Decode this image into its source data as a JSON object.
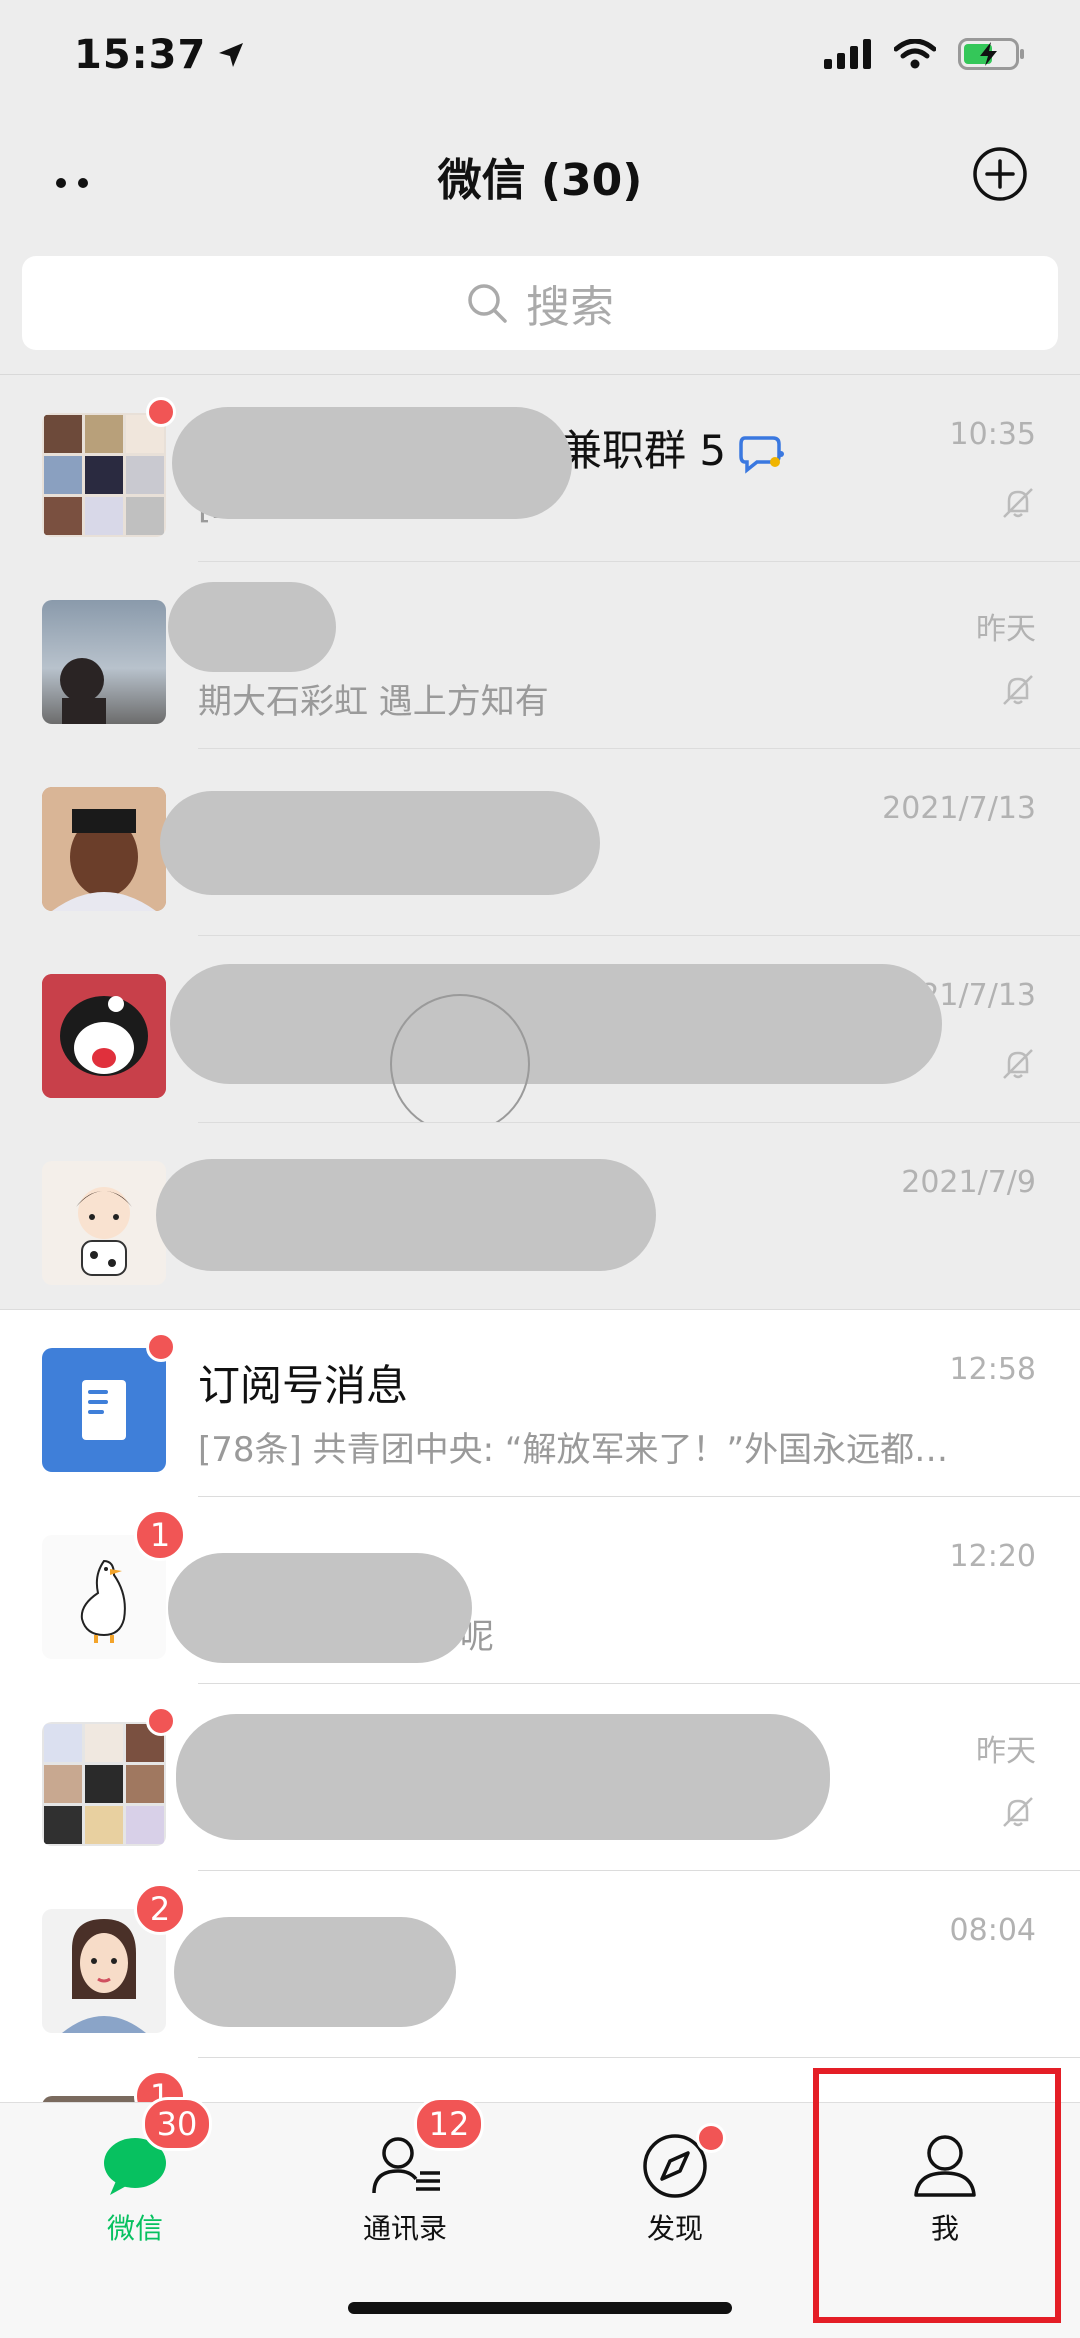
{
  "status_bar": {
    "time": "15:37"
  },
  "header": {
    "title": "微信 (30)"
  },
  "search": {
    "placeholder": "搜索"
  },
  "chats": [
    {
      "name": "兼职群 5",
      "preview": "[23…",
      "time": "10:35",
      "muted": true
    },
    {
      "name": "",
      "preview": "期大石彩虹 遇上方知有",
      "time": "昨天",
      "muted": true
    },
    {
      "name": "",
      "preview": "",
      "time": "2021/7/13",
      "muted": false
    },
    {
      "name": "",
      "preview": "",
      "time": "2021/7/13",
      "muted": true
    },
    {
      "name": "",
      "preview": "",
      "time": "2021/7/9",
      "muted": false
    },
    {
      "name": "订阅号消息",
      "preview": "[78条] 共青团中央: “解放军来了！”外国永远都…",
      "time": "12:58",
      "muted": false
    },
    {
      "name": "",
      "preview": "呢",
      "time": "12:20",
      "muted": false,
      "badge": "1"
    },
    {
      "name": "",
      "preview": "",
      "time": "昨天",
      "muted": true
    },
    {
      "name": "",
      "preview": "",
      "time": "08:04",
      "muted": false,
      "badge": "2"
    },
    {
      "badge": "1"
    }
  ],
  "tabbar": {
    "tabs": [
      {
        "label": "微信",
        "badge": "30",
        "icon": "chat-bubble-icon",
        "active": true
      },
      {
        "label": "通讯录",
        "badge": "12",
        "icon": "contacts-icon"
      },
      {
        "label": "发现",
        "icon": "compass-icon"
      },
      {
        "label": "我",
        "icon": "person-icon"
      }
    ]
  },
  "colors": {
    "accent": "#07c160",
    "badge": "#f15555",
    "highlight_box": "#e41e26"
  }
}
